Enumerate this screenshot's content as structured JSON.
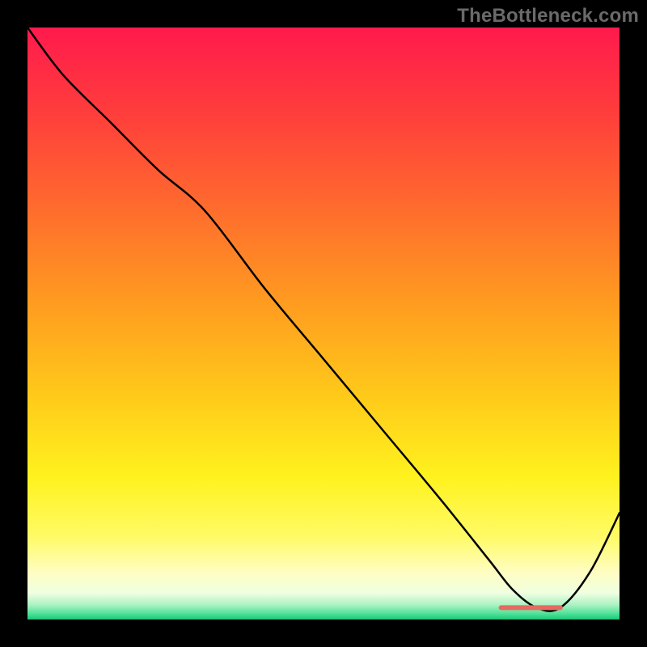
{
  "attribution": "TheBottleneck.com",
  "colors": {
    "curve": "#000000",
    "marker": "#e66a5f"
  },
  "gradient_stops": [
    {
      "offset": 0.0,
      "color": "#ff1a4d"
    },
    {
      "offset": 0.14,
      "color": "#ff3c3c"
    },
    {
      "offset": 0.3,
      "color": "#ff6a2e"
    },
    {
      "offset": 0.46,
      "color": "#ff9a20"
    },
    {
      "offset": 0.62,
      "color": "#ffc91a"
    },
    {
      "offset": 0.76,
      "color": "#fff21e"
    },
    {
      "offset": 0.86,
      "color": "#fffb66"
    },
    {
      "offset": 0.92,
      "color": "#fffdc2"
    },
    {
      "offset": 0.955,
      "color": "#f0ffe0"
    },
    {
      "offset": 0.975,
      "color": "#aef2c4"
    },
    {
      "offset": 0.99,
      "color": "#4fe298"
    },
    {
      "offset": 1.0,
      "color": "#19c777"
    }
  ],
  "chart_data": {
    "type": "line",
    "title": "",
    "xlabel": "",
    "ylabel": "",
    "x_range": [
      0,
      100
    ],
    "y_range": [
      0,
      100
    ],
    "x": [
      0,
      6,
      14,
      22,
      30,
      40,
      50,
      60,
      70,
      78,
      82,
      86,
      90,
      95,
      100
    ],
    "values": [
      100,
      92,
      84,
      76,
      69,
      56,
      44,
      32,
      20,
      10,
      5,
      2,
      2,
      8,
      18
    ],
    "marker": {
      "x_start": 80,
      "x_end": 90,
      "y": 2
    }
  }
}
